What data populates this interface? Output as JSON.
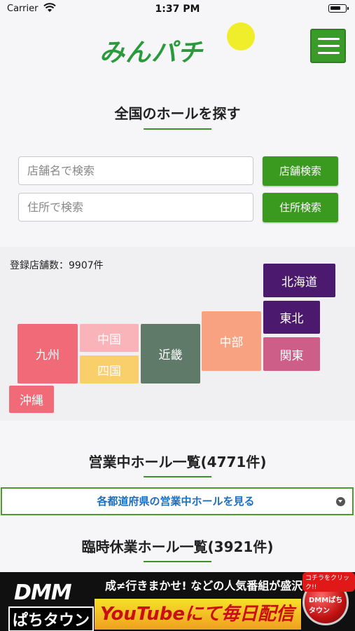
{
  "status_bar": {
    "carrier": "Carrier",
    "time": "1:37 PM"
  },
  "header": {
    "logo_text": "みんパチ",
    "logo_colors": {
      "text": "#2a9a3c",
      "sun": "#f0ee2a"
    }
  },
  "search_section": {
    "title": "全国のホールを探す",
    "store_input_placeholder": "店舗名で検索",
    "store_button": "店舗検索",
    "address_input_placeholder": "住所で検索",
    "address_button": "住所検索"
  },
  "map": {
    "registered_count": "登録店舗数：9907件",
    "regions": [
      {
        "label": "北海道",
        "color": "#4b1a6e"
      },
      {
        "label": "東北",
        "color": "#4b1a6e"
      },
      {
        "label": "関東",
        "color": "#cd5e87"
      },
      {
        "label": "中部",
        "color": "#f9a282"
      },
      {
        "label": "近畿",
        "color": "#5f7a69"
      },
      {
        "label": "中国",
        "color": "#f8b4b8"
      },
      {
        "label": "四国",
        "color": "#f8cf6a"
      },
      {
        "label": "九州",
        "color": "#f06a78"
      },
      {
        "label": "沖縄",
        "color": "#f06a78"
      }
    ]
  },
  "open_halls": {
    "title": "営業中ホール一覧(4771件)",
    "accordion_label": "各都道府県の営業中ホールを見る"
  },
  "closed_halls": {
    "title": "臨時休業ホール一覧(3921件)"
  },
  "banner": {
    "dmm": "DMM",
    "pachi": "ぱちタウン",
    "top_text": "成≠行きまかせ! などの人気番組が盛沢山!!",
    "main_text": "YouTubeにて毎日配信中!!",
    "click_text": "コチラをクリック!!",
    "button_text": "DMMぱちタウン"
  }
}
